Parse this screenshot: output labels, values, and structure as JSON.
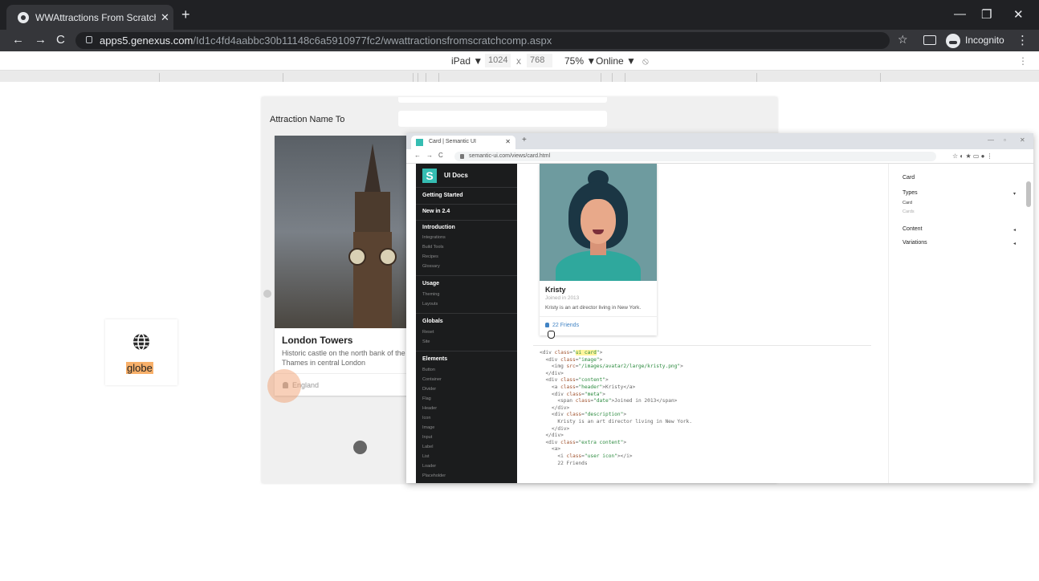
{
  "browser": {
    "tab_title": "WWAttractions From Scratch Com",
    "tab_close": "✕",
    "new_tab": "+",
    "window_controls": [
      "—",
      "❐",
      "✕"
    ],
    "nav": [
      "←",
      "→",
      "C"
    ],
    "url_domain": "apps5.genexus.com",
    "url_path": "/Id1c4fd4aabbc30b11148c6a5910977fc2/wwattractionsfromscratchcomp.aspx",
    "star": "☆",
    "incognito_label": "Incognito",
    "menu": "⋮"
  },
  "device_toolbar": {
    "device": "iPad ▼",
    "width": "1024",
    "times": "x",
    "height": "768",
    "zoom": "75% ▼",
    "network": "Online ▼",
    "rotate": "⦸",
    "more": "⋮"
  },
  "page": {
    "attraction_label": "Attraction Name To",
    "card": {
      "title": "London Towers",
      "description": "Historic castle on the north bank of the River Thames in central London",
      "country": "England"
    },
    "globe": {
      "label": "globe",
      "icon": "globe-icon"
    }
  },
  "semantic": {
    "tab_title": "Card | Semantic UI",
    "tab_close": "✕",
    "new_tab": "+",
    "window_controls": [
      "—",
      "▫",
      "✕"
    ],
    "nav": [
      "←",
      "→",
      "C"
    ],
    "url": "semantic-ui.com/views/card.html",
    "tools": "☆ ◐ ★ ▭ ● ⋮",
    "logo": "S",
    "logo_text": "UI Docs",
    "sidebar": {
      "getting_started": "Getting Started",
      "new_in": "New in 2.4",
      "introduction": "Introduction",
      "introduction_items": [
        "Integrations",
        "Build Tools",
        "Recipes",
        "Glossary"
      ],
      "usage": "Usage",
      "usage_items": [
        "Theming",
        "Layouts"
      ],
      "globals": "Globals",
      "globals_items": [
        "Reset",
        "Site"
      ],
      "elements": "Elements",
      "elements_items": [
        "Button",
        "Container",
        "Divider",
        "Flag",
        "Header",
        "Icon",
        "Image",
        "Input",
        "Label",
        "List",
        "Loader",
        "Placeholder"
      ]
    },
    "card": {
      "name": "Kristy",
      "meta": "Joined in 2013",
      "description": "Kristy is an art director living in New York.",
      "friends": "22 Friends"
    },
    "toc": {
      "title": "Card",
      "types": "Types",
      "types_items": [
        "Card",
        "Cards"
      ],
      "content": "Content",
      "variations": "Variations",
      "chev_down": "▾",
      "chev_left": "◂"
    }
  }
}
